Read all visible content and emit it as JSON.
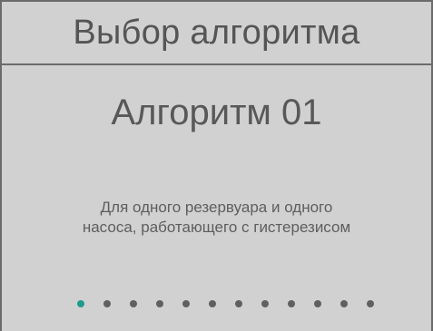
{
  "header": {
    "title": "Выбор алгоритма"
  },
  "algorithm": {
    "name": "Алгоритм 01",
    "description": "Для одного резервуара и одного\nнасоса, работающего с гистерезисом"
  },
  "pager": {
    "total": 12,
    "active_index": 0,
    "active_color": "#1f9b8e",
    "inactive_color": "#606060"
  }
}
